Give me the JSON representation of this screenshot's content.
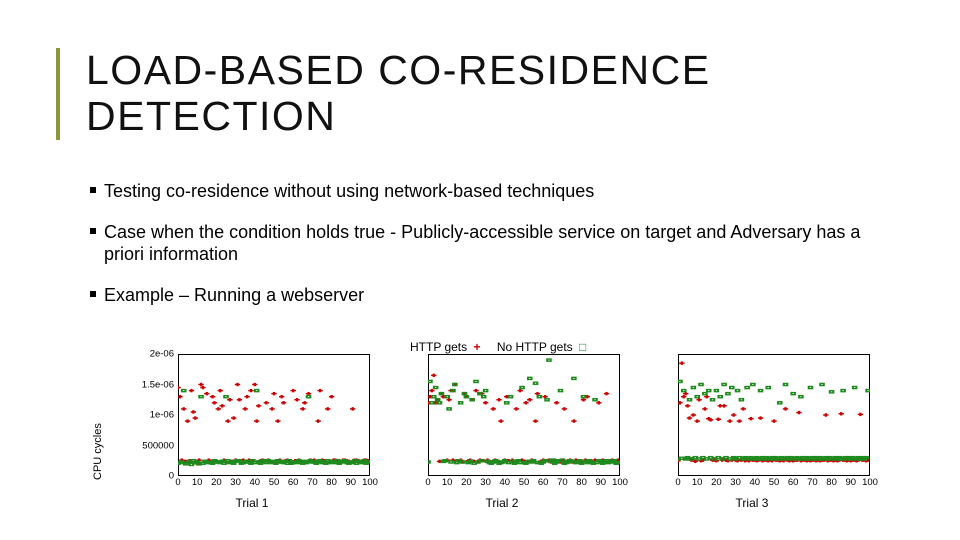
{
  "slide": {
    "title": "LOAD-BASED CO-RESIDENCE DETECTION",
    "bullets": [
      "Testing co-residence without using network-based techniques",
      "Case when the condition holds true  - Publicly-accessible service on target and               Adversary has a priori information",
      "Example – Running a webserver"
    ]
  },
  "chart_data": {
    "type": "scatter",
    "ylabel": "CPU cycles",
    "legend": [
      "HTTP gets",
      "No HTTP gets"
    ],
    "yticks": [
      "0",
      "500000",
      "1e-06",
      "1.5e-06",
      "2e-06"
    ],
    "ylim": [
      0,
      2000000
    ],
    "xticks": [
      "0",
      "10",
      "20",
      "30",
      "40",
      "50",
      "60",
      "70",
      "80",
      "90",
      "100"
    ],
    "xlim": [
      0,
      100
    ],
    "series_names": [
      "HTTP gets",
      "No HTTP gets"
    ],
    "panels": [
      {
        "xlabel": "Trial 1",
        "series": [
          {
            "name": "HTTP gets",
            "values": [
              1450000,
              1300000,
              260000,
              1100000,
              240000,
              900000,
              250000,
              1400000,
              1050000,
              950000,
              200000,
              260000,
              1500000,
              1450000,
              240000,
              1350000,
              260000,
              230000,
              1300000,
              1200000,
              250000,
              1100000,
              1400000,
              1150000,
              260000,
              230000,
              900000,
              1250000,
              240000,
              950000,
              260000,
              1500000,
              1250000,
              230000,
              260000,
              1100000,
              1300000,
              260000,
              1400000,
              240000,
              1500000,
              900000,
              1150000,
              250000,
              260000,
              230000,
              1200000,
              260000,
              240000,
              1100000,
              1350000,
              230000,
              900000,
              260000,
              1300000,
              1200000,
              250000,
              260000,
              240000,
              230000,
              1400000,
              250000,
              1250000,
              260000,
              240000,
              1100000,
              1200000,
              230000,
              1350000,
              260000,
              250000,
              260000,
              240000,
              900000,
              1400000,
              260000,
              250000,
              230000,
              1100000,
              240000,
              1300000,
              260000,
              260000,
              250000,
              240000,
              230000,
              260000,
              260000,
              250000,
              240000,
              230000,
              1100000,
              260000,
              260000,
              250000,
              240000,
              230000,
              260000,
              260000,
              250000
            ]
          },
          {
            "name": "No HTTP gets",
            "values": [
              210000,
              220000,
              230000,
              1400000,
              200000,
              210000,
              240000,
              190000,
              250000,
              220000,
              230000,
              200000,
              1300000,
              210000,
              240000,
              230000,
              220000,
              220000,
              210000,
              250000,
              230000,
              230000,
              220000,
              240000,
              210000,
              1300000,
              250000,
              220000,
              230000,
              210000,
              240000,
              250000,
              250000,
              210000,
              220000,
              230000,
              240000,
              230000,
              210000,
              250000,
              220000,
              1400000,
              230000,
              210000,
              240000,
              250000,
              220000,
              250000,
              230000,
              220000,
              240000,
              210000,
              250000,
              230000,
              230000,
              220000,
              240000,
              210000,
              250000,
              210000,
              220000,
              230000,
              220000,
              250000,
              230000,
              210000,
              240000,
              220000,
              1300000,
              250000,
              230000,
              230000,
              210000,
              240000,
              250000,
              220000,
              230000,
              210000,
              250000,
              220000,
              240000,
              230000,
              220000,
              250000,
              210000,
              230000,
              240000,
              250000,
              220000,
              210000,
              230000,
              220000,
              250000,
              210000,
              240000,
              230000,
              220000,
              250000,
              210000,
              230000
            ]
          }
        ]
      },
      {
        "xlabel": "Trial 2",
        "series": [
          {
            "name": "HTTP gets",
            "values": [
              1200000,
              1300000,
              1400000,
              1650000,
              1200000,
              1250000,
              240000,
              1350000,
              1300000,
              250000,
              260000,
              1250000,
              1400000,
              260000,
              1500000,
              250000,
              240000,
              260000,
              230000,
              1350000,
              1300000,
              250000,
              260000,
              1250000,
              240000,
              1400000,
              230000,
              260000,
              1350000,
              250000,
              1200000,
              260000,
              240000,
              230000,
              1100000,
              260000,
              250000,
              1250000,
              900000,
              230000,
              260000,
              1300000,
              250000,
              240000,
              260000,
              230000,
              1100000,
              250000,
              1400000,
              260000,
              240000,
              1200000,
              230000,
              1250000,
              260000,
              250000,
              900000,
              1350000,
              230000,
              240000,
              260000,
              1300000,
              250000,
              260000,
              230000,
              240000,
              260000,
              1200000,
              250000,
              230000,
              260000,
              1100000,
              240000,
              250000,
              260000,
              230000,
              900000,
              260000,
              250000,
              240000,
              230000,
              1250000,
              260000,
              1300000,
              250000,
              230000,
              240000,
              260000,
              250000,
              1200000,
              230000,
              260000,
              240000,
              1350000,
              230000,
              250000,
              260000,
              240000,
              230000,
              260000
            ]
          },
          {
            "name": "No HTTP gets",
            "values": [
              230000,
              1550000,
              1200000,
              1300000,
              1450000,
              1250000,
              1200000,
              1350000,
              240000,
              250000,
              1300000,
              1100000,
              230000,
              1400000,
              1500000,
              220000,
              250000,
              1200000,
              230000,
              1350000,
              1300000,
              220000,
              240000,
              1250000,
              210000,
              1550000,
              230000,
              1350000,
              250000,
              1300000,
              1400000,
              240000,
              220000,
              210000,
              230000,
              250000,
              240000,
              210000,
              220000,
              230000,
              250000,
              1200000,
              220000,
              1300000,
              240000,
              210000,
              230000,
              250000,
              220000,
              1450000,
              220000,
              210000,
              240000,
              1600000,
              230000,
              250000,
              1520000,
              220000,
              1300000,
              210000,
              230000,
              250000,
              1250000,
              1900000,
              240000,
              260000,
              210000,
              230000,
              250000,
              1400000,
              260000,
              210000,
              220000,
              230000,
              250000,
              240000,
              1600000,
              220000,
              230000,
              250000,
              210000,
              1300000,
              240000,
              220000,
              250000,
              230000,
              210000,
              1250000,
              220000,
              250000,
              240000,
              210000,
              230000,
              250000,
              220000,
              240000,
              230000,
              250000,
              210000,
              220000
            ]
          }
        ]
      },
      {
        "xlabel": "Trial 3",
        "series": [
          {
            "name": "HTTP gets",
            "values": [
              250000,
              1200000,
              1850000,
              1300000,
              1350000,
              1150000,
              950000,
              260000,
              1000000,
              240000,
              900000,
              1250000,
              250000,
              260000,
              1100000,
              1300000,
              940000,
              920000,
              260000,
              260000,
              250000,
              930000,
              1150000,
              260000,
              1150000,
              260000,
              250000,
              900000,
              260000,
              1000000,
              260000,
              250000,
              900000,
              260000,
              1100000,
              250000,
              260000,
              250000,
              940000,
              260000,
              260000,
              250000,
              260000,
              950000,
              250000,
              260000,
              260000,
              250000,
              260000,
              250000,
              900000,
              260000,
              260000,
              250000,
              260000,
              250000,
              1100000,
              260000,
              250000,
              260000,
              250000,
              260000,
              260000,
              1040000,
              250000,
              260000,
              260000,
              250000,
              260000,
              250000,
              260000,
              260000,
              250000,
              260000,
              250000,
              260000,
              260000,
              1000000,
              250000,
              260000,
              260000,
              250000,
              260000,
              250000,
              260000,
              1020000,
              260000,
              260000,
              250000,
              260000,
              250000,
              260000,
              260000,
              250000,
              260000,
              1010000,
              260000,
              260000,
              250000,
              260000
            ]
          },
          {
            "name": "No HTTP gets",
            "values": [
              280000,
              1550000,
              290000,
              1400000,
              280000,
              300000,
              1250000,
              280000,
              1450000,
              300000,
              1300000,
              280000,
              1500000,
              300000,
              1350000,
              280000,
              1400000,
              300000,
              1250000,
              280000,
              1400000,
              300000,
              1300000,
              280000,
              1500000,
              300000,
              1350000,
              280000,
              1450000,
              300000,
              280000,
              1400000,
              300000,
              1250000,
              280000,
              300000,
              1450000,
              280000,
              300000,
              1500000,
              280000,
              300000,
              280000,
              1400000,
              300000,
              280000,
              300000,
              1450000,
              280000,
              300000,
              280000,
              300000,
              280000,
              1200000,
              300000,
              280000,
              1500000,
              300000,
              280000,
              300000,
              1350000,
              280000,
              300000,
              280000,
              1300000,
              300000,
              280000,
              300000,
              280000,
              1450000,
              300000,
              280000,
              300000,
              280000,
              300000,
              1500000,
              280000,
              300000,
              280000,
              300000,
              1380000,
              280000,
              300000,
              280000,
              300000,
              280000,
              1400000,
              300000,
              280000,
              300000,
              280000,
              300000,
              1450000,
              280000,
              300000,
              280000,
              300000,
              280000,
              300000,
              1400000
            ]
          }
        ]
      }
    ]
  }
}
